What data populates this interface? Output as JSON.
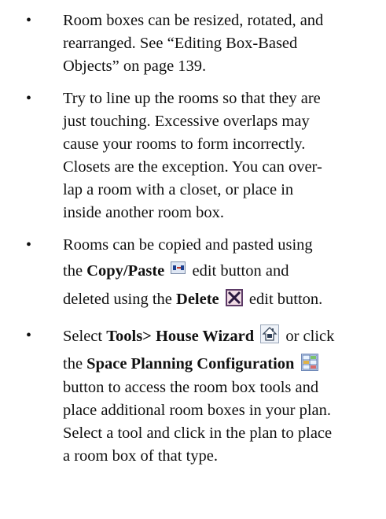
{
  "bullet_char": "•",
  "items": [
    {
      "lines": [
        "Room boxes can be resized, rotated, and",
        "rearranged. See “Editing Box-Based",
        "Objects” on page 139."
      ]
    },
    {
      "lines": [
        "Try to line up the rooms so that they are",
        "just touching. Excessive overlaps may",
        "cause your rooms to form incorrectly.",
        "Closets are the exception. You can over-",
        "lap a room with a closet, or place in",
        "inside another room box."
      ]
    },
    {
      "line1": "Rooms can be copied and pasted using",
      "line2_pre": "the ",
      "copy_label": "Copy/Paste",
      "line2_post": " edit button and",
      "line3_pre": "deleted using the ",
      "delete_label": "Delete",
      "line3_post": " edit button."
    },
    {
      "line1_pre": "Select ",
      "tools_label": "Tools> House Wizard",
      "line1_post": " or click",
      "line2_pre": "the ",
      "space_label": "Space Planning Configuration",
      "lines": [
        "button to access the room box tools and",
        "place additional room boxes in your plan.",
        "Select a tool and click in the plan to place",
        "a room box of that type."
      ]
    }
  ],
  "icons": {
    "copy": "copy-paste-icon",
    "delete": "delete-icon",
    "house": "house-wizard-icon",
    "space": "space-planning-icon"
  }
}
